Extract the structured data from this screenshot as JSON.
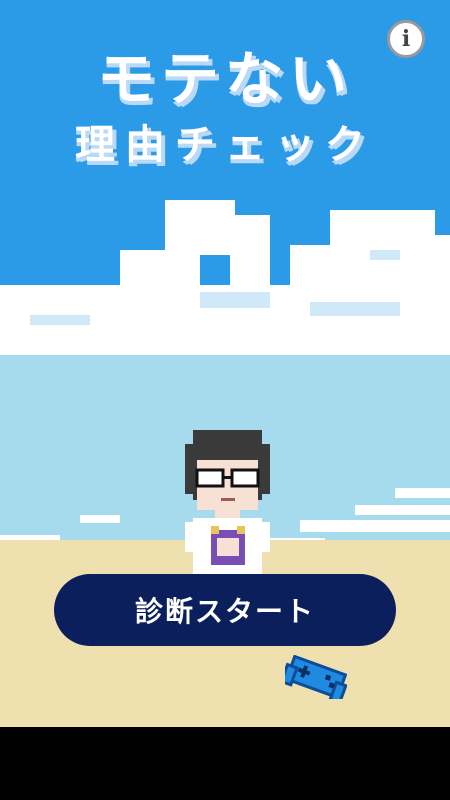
{
  "title": {
    "line1": "モテない",
    "line2": "理由チェック"
  },
  "info_button": {
    "label": "i",
    "icon": "info-icon"
  },
  "start_button": {
    "label": "診断スタート"
  },
  "decor": {
    "character": "pixel-man-with-glasses",
    "controller": "game-controller-icon"
  },
  "colors": {
    "sky": "#2b9be8",
    "beach_sky": "#a6dbee",
    "sand": "#efe0b0",
    "button": "#0b1f5c"
  }
}
